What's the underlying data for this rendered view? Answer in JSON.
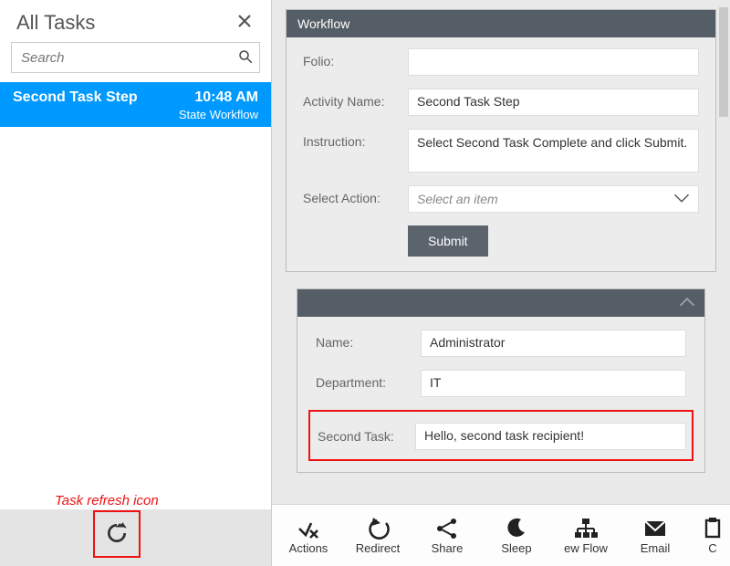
{
  "sidebar": {
    "title": "All Tasks",
    "search_placeholder": "Search",
    "task": {
      "name": "Second Task Step",
      "time": "10:48 AM",
      "workflow": "State Workflow"
    },
    "refresh_annotation": "Task refresh icon"
  },
  "workflow_card": {
    "header": "Workflow",
    "folio_label": "Folio:",
    "folio_value": "",
    "activity_label": "Activity Name:",
    "activity_value": "Second Task Step",
    "instruction_label": "Instruction:",
    "instruction_value": "Select Second Task Complete and click Submit.",
    "select_label": "Select Action:",
    "select_placeholder": "Select an item",
    "submit_label": "Submit"
  },
  "detail_card": {
    "name_label": "Name:",
    "name_value": "Administrator",
    "dept_label": "Department:",
    "dept_value": "IT",
    "second_task_label": "Second Task:",
    "second_task_value": "Hello, second task recipient!"
  },
  "toolbar": {
    "actions": "Actions",
    "redirect": "Redirect",
    "share": "Share",
    "sleep": "Sleep",
    "viewflow": "ew Flow",
    "email": "Email",
    "last": "C"
  }
}
